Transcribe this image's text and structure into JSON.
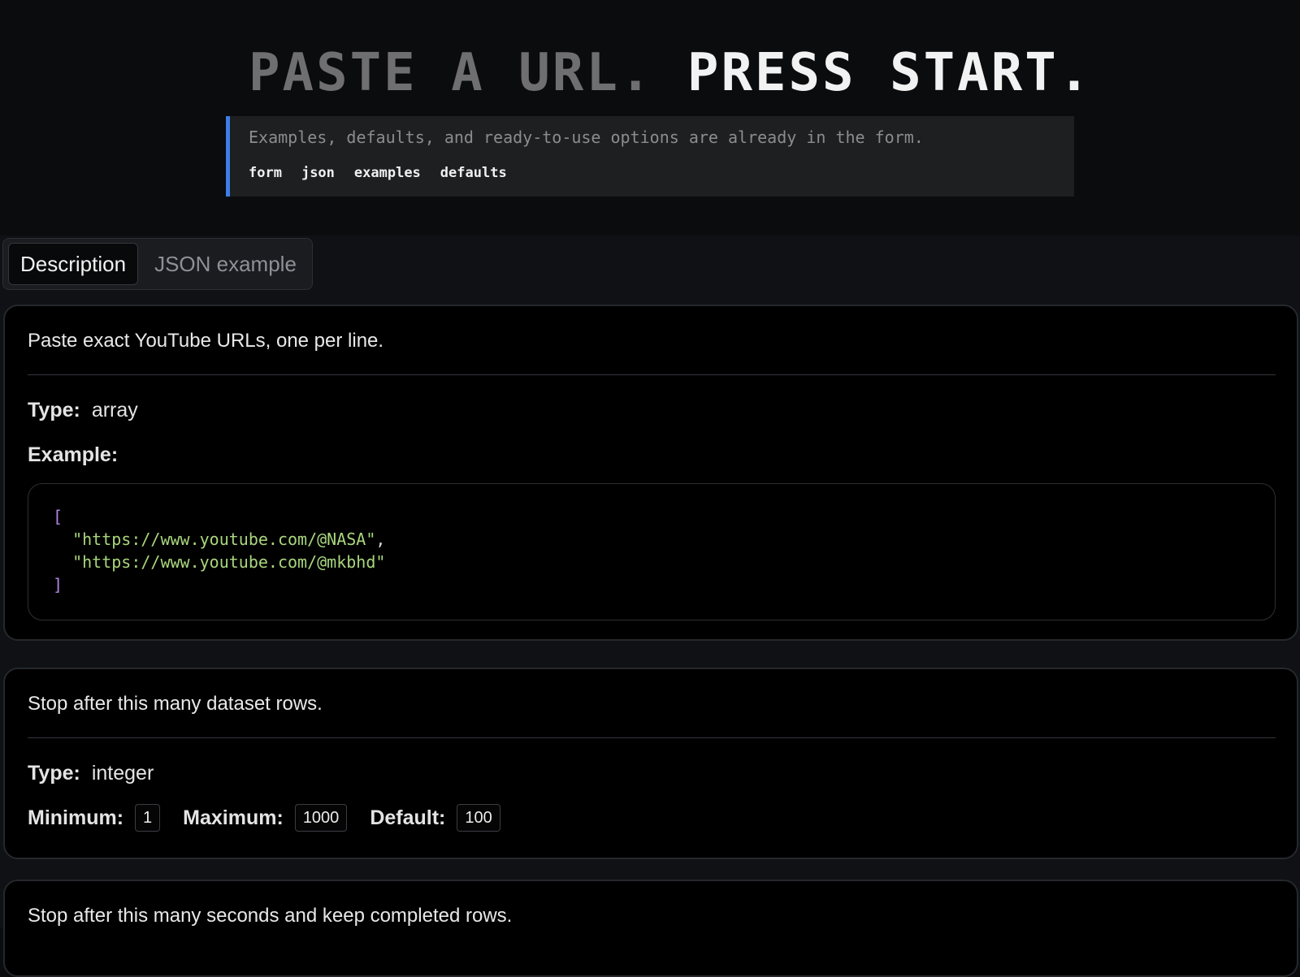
{
  "hero": {
    "title_dim": "PASTE A URL.",
    "title_bright": "PRESS START.",
    "note": "Examples, defaults, and ready-to-use options are already in the form.",
    "tags": [
      "form",
      "json",
      "examples",
      "defaults"
    ],
    "accent_color": "#3d7ee6"
  },
  "tabs": [
    {
      "label": "Description",
      "active": true
    },
    {
      "label": "JSON example",
      "active": false
    }
  ],
  "fields": [
    {
      "description": "Paste exact YouTube URLs, one per line.",
      "type_label": "Type:",
      "type_value": "array",
      "example_label": "Example:",
      "example_code": {
        "open": "[",
        "items": [
          "\"https://www.youtube.com/@NASA\"",
          "\"https://www.youtube.com/@mkbhd\""
        ],
        "separator": ",",
        "close": "]"
      }
    },
    {
      "description": "Stop after this many dataset rows.",
      "type_label": "Type:",
      "type_value": "integer",
      "minimum_label": "Minimum:",
      "minimum_value": "1",
      "maximum_label": "Maximum:",
      "maximum_value": "1000",
      "default_label": "Default:",
      "default_value": "100"
    },
    {
      "description": "Stop after this many seconds and keep completed rows."
    }
  ]
}
